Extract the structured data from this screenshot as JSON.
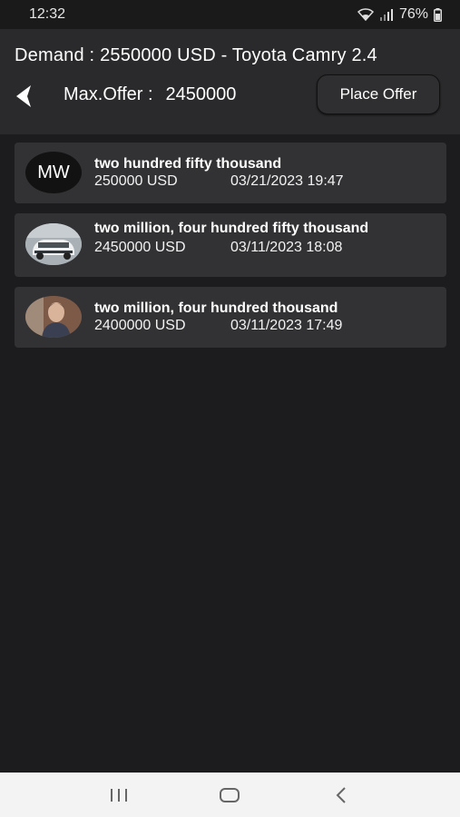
{
  "status_bar": {
    "time": "12:32",
    "battery": "76%"
  },
  "header": {
    "demand": "Demand : 2550000 USD - Toyota Camry 2.4",
    "max_offer_label": "Max.Offer :",
    "max_offer_value": "2450000",
    "place_offer_label": "Place Offer"
  },
  "offers": [
    {
      "avatar_type": "initials",
      "initials": "MW",
      "amount_words": "two hundred fifty thousand",
      "amount": "250000 USD",
      "datetime": "03/21/2023 19:47"
    },
    {
      "avatar_type": "car-photo",
      "amount_words": "two million, four hundred fifty thousand",
      "amount": "2450000 USD",
      "datetime": "03/11/2023 18:08"
    },
    {
      "avatar_type": "person-photo",
      "amount_words": "two million, four hundred thousand",
      "amount": "2400000 USD",
      "datetime": "03/11/2023 17:49"
    }
  ],
  "icons": {
    "back": "chevron-left-icon",
    "wifi": "wifi-icon",
    "signal": "signal-icon",
    "battery": "battery-icon"
  },
  "colors": {
    "background": "#1c1c1e",
    "header": "#2a2a2c",
    "card": "#323234",
    "nav_bar": "#f3f3f3"
  }
}
